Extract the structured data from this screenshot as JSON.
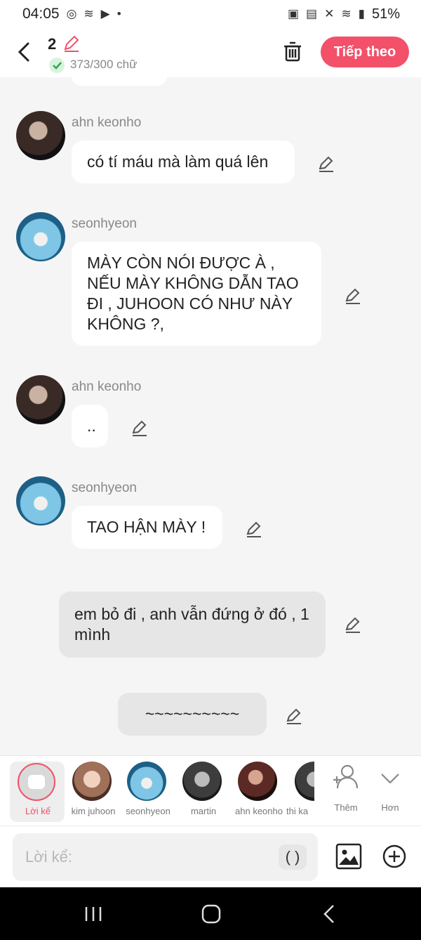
{
  "status": {
    "time": "04:05",
    "battery": "51%"
  },
  "header": {
    "chapter": "2",
    "char_count": "373/300 chữ",
    "next_label": "Tiếp theo"
  },
  "messages": [
    {
      "sender": "ahn keonho",
      "text": "có tí máu mà làm quá lên"
    },
    {
      "sender": "seonhyeon",
      "text": "MÀY CÒN NÓI ĐƯỢC À , NẾU MÀY KHÔNG DẪN TAO ĐI , JUHOON CÓ NHƯ NÀY KHÔNG ?,"
    },
    {
      "sender": "ahn keonho",
      "text": ".."
    },
    {
      "sender": "seonhyeon",
      "text": "TAO HẬN MÀY !"
    },
    {
      "text": "em bỏ đi , anh vẫn đứng ở đó , 1 mình"
    },
    {
      "text": "~~~~~~~~~~"
    }
  ],
  "characters": [
    {
      "label": "Lời kể"
    },
    {
      "label": "kim juhoon"
    },
    {
      "label": "seonhyeon"
    },
    {
      "label": "martin"
    },
    {
      "label": "ahn keonho"
    },
    {
      "label": "thi ka"
    }
  ],
  "tools": {
    "add_label": "Thêm",
    "more_label": "Hơn"
  },
  "input": {
    "placeholder": "Lời kể:",
    "paren": "( )"
  },
  "colors": {
    "accent": "#f3506a"
  }
}
